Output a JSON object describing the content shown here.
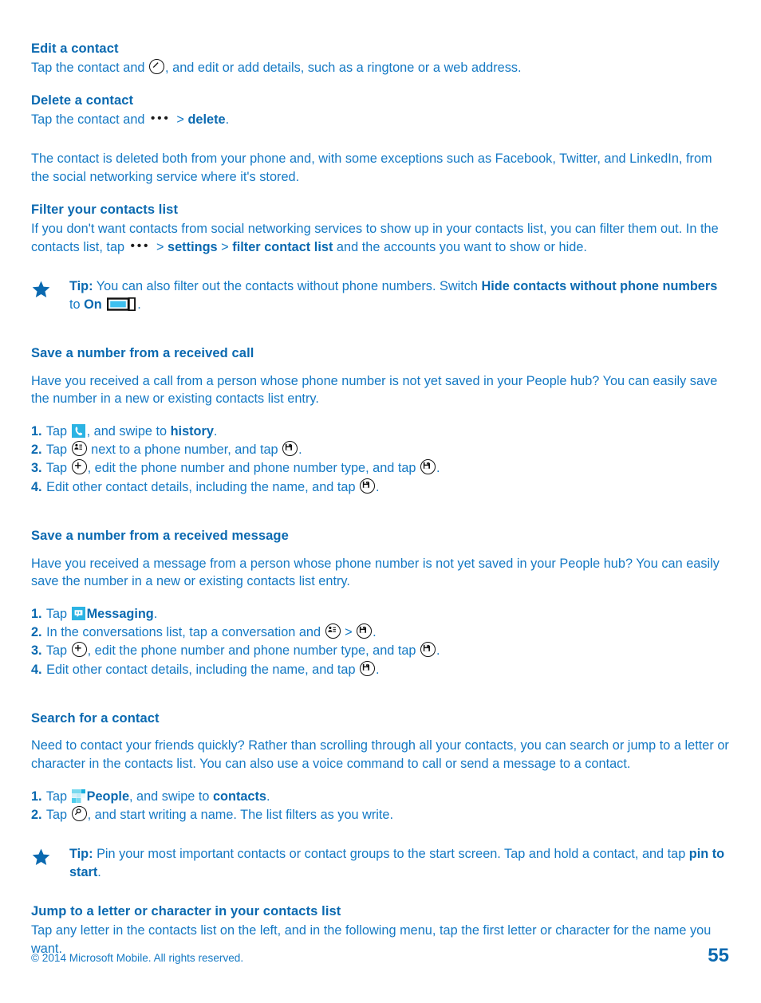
{
  "colors": {
    "heading": "#0a69b0",
    "body": "#1479c4",
    "tile_cyan": "#2bb3e3",
    "toggle_fill": "#3fc0ef",
    "icon_outline": "#101010"
  },
  "sections": {
    "edit_contact": {
      "heading": "Edit a contact",
      "line_a": "Tap the contact and ",
      "line_b": ", and edit or add details, such as a ringtone or a web address."
    },
    "delete_contact": {
      "heading": "Delete a contact",
      "line_a": "Tap the contact and ",
      "line_b": " > ",
      "bold_delete": "delete",
      "line_c": ".",
      "para": "The contact is deleted both from your phone and, with some exceptions such as Facebook, Twitter, and LinkedIn, from the social networking service where it's stored."
    },
    "filter_contacts": {
      "heading": "Filter your contacts list",
      "line_a": "If you don't want contacts from social networking services to show up in your contacts list, you can filter them out. In the contacts list, tap ",
      "line_b": " > ",
      "bold_settings": "settings",
      "line_c": " > ",
      "bold_filter": "filter contact list",
      "line_d": " and the accounts you want to show or hide.",
      "tip": {
        "label": "Tip:",
        "text_a": " You can also filter out the contacts without phone numbers. Switch ",
        "bold_hide": "Hide contacts without phone numbers",
        "text_b": " to ",
        "bold_on": "On",
        "text_c": "."
      }
    },
    "save_from_call": {
      "heading": "Save a number from a received call",
      "para": "Have you received a call from a person whose phone number is not yet saved in your People hub? You can easily save the number in a new or existing contacts list entry.",
      "steps": [
        {
          "num": "1.",
          "a": " Tap ",
          "icon": "phone-tile-icon",
          "b": ", and swipe to ",
          "bold": "history",
          "c": "."
        },
        {
          "num": "2.",
          "a": " Tap ",
          "icon": "contact-card-circle-icon",
          "b": " next to a phone number, and tap ",
          "icon2": "save-circle-icon",
          "c": "."
        },
        {
          "num": "3.",
          "a": " Tap ",
          "icon": "plus-circle-icon",
          "b": ", edit the phone number and phone number type, and tap ",
          "icon2": "save-circle-icon",
          "c": "."
        },
        {
          "num": "4.",
          "a": " Edit other contact details, including the name, and tap ",
          "icon2": "save-circle-icon",
          "c": "."
        }
      ]
    },
    "save_from_message": {
      "heading": "Save a number from a received message",
      "para": "Have you received a message from a person whose phone number is not yet saved in your People hub? You can easily save the number in a new or existing contacts list entry.",
      "steps": [
        {
          "num": "1.",
          "a": " Tap ",
          "icon": "messaging-tile-icon",
          "bold": "Messaging",
          "c": "."
        },
        {
          "num": "2.",
          "a": " In the conversations list, tap a conversation and ",
          "icon": "contact-card-circle-icon",
          "b": " > ",
          "icon2": "save-circle-icon",
          "c": "."
        },
        {
          "num": "3.",
          "a": " Tap ",
          "icon": "plus-circle-icon",
          "b": ", edit the phone number and phone number type, and tap ",
          "icon2": "save-circle-icon",
          "c": "."
        },
        {
          "num": "4.",
          "a": " Edit other contact details, including the name, and tap ",
          "icon2": "save-circle-icon",
          "c": "."
        }
      ]
    },
    "search_contact": {
      "heading": "Search for a contact",
      "para": "Need to contact your friends quickly? Rather than scrolling through all your contacts, you can search or jump to a letter or character in the contacts list. You can also use a voice command to call or send a message to a contact.",
      "steps": [
        {
          "num": "1.",
          "a": " Tap ",
          "icon": "people-tile-icon",
          "bold": "People",
          "b": ", and swipe to ",
          "bold2": "contacts",
          "c": "."
        },
        {
          "num": "2.",
          "a": " Tap ",
          "icon": "search-circle-icon",
          "b": ", and start writing a name. The list filters as you write."
        }
      ],
      "tip": {
        "label": "Tip:",
        "text_a": " Pin your most important contacts or contact groups to the start screen. Tap and hold a contact, and tap ",
        "bold_pin": "pin to start",
        "text_b": "."
      }
    },
    "jump_letter": {
      "heading": "Jump to a letter or character in your contacts list",
      "para": "Tap any letter in the contacts list on the left, and in the following menu, tap the first letter or character for the name you want."
    }
  },
  "footer": {
    "copyright": "© 2014 Microsoft Mobile. All rights reserved.",
    "page_number": "55"
  }
}
